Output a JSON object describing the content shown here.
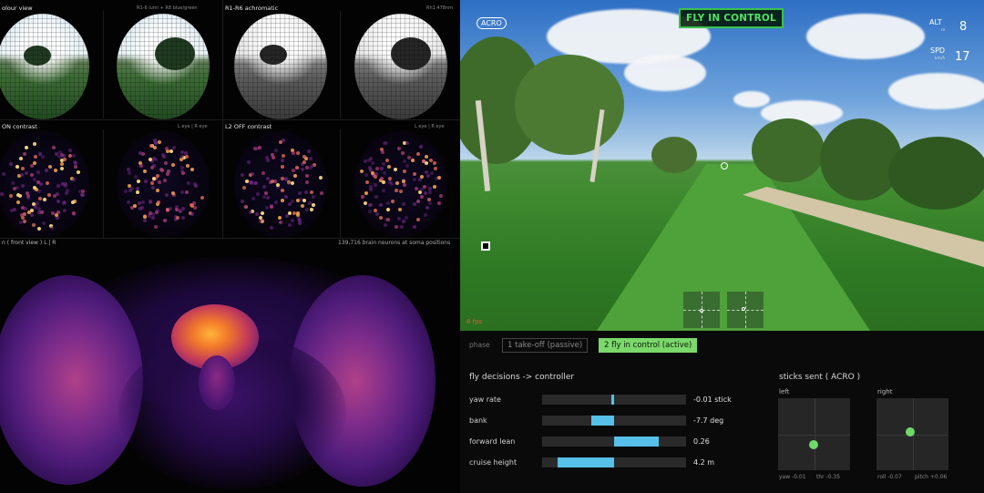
{
  "retina": {
    "top_left_label": "olour view",
    "top_left_meta": "R1-6 lumi + R8 blue/green",
    "top_right_label": "R1-R6 achromatic",
    "top_right_meta": "Rh1 478nm",
    "mid_left_label": "ON contrast",
    "mid_left_meta": "L eye | R eye",
    "mid_right_label": "L2 OFF contrast",
    "mid_right_meta": "L eye | R eye"
  },
  "brain": {
    "view_label": "n  ( front view )  L | R",
    "neurons_label": "139,716 brain neurons at soma positions"
  },
  "sim": {
    "mode_badge": "ACRO",
    "status": "FLY IN CONTROL",
    "alt_label": "ALT",
    "alt_unit": "m",
    "alt_value": "8",
    "spd_label": "SPD",
    "spd_unit": "km/h",
    "spd_value": "17",
    "fps_label": "8 fps",
    "accent": "#38c24a"
  },
  "phase": {
    "label": "phase",
    "items": [
      {
        "label": "1  take-off  (passive)",
        "state": "inactive"
      },
      {
        "label": "2  fly in control  (active)",
        "state": "active"
      }
    ]
  },
  "decisions": {
    "title": "fly decisions  ->  controller",
    "rows": [
      {
        "label": "yaw rate",
        "value": "-0.01 stick",
        "fraction": -0.01
      },
      {
        "label": "bank",
        "value": "-7.7 deg",
        "fraction": -0.32
      },
      {
        "label": "forward lean",
        "value": "0.26",
        "fraction": 0.62
      },
      {
        "label": "cruise height",
        "value": "4.2 m",
        "fraction": -0.78
      }
    ],
    "bar_color": "#56c0e8"
  },
  "sticks": {
    "title": "sticks sent  ( ACRO )",
    "left": {
      "label": "left",
      "x": -0.01,
      "y": -0.35,
      "readout_a": "yaw -0.01",
      "readout_b": "thr -0.35"
    },
    "right": {
      "label": "right",
      "x": -0.07,
      "y": 0.06,
      "readout_a": "roll -0.07",
      "readout_b": "pitch +0.06"
    },
    "dot_color": "#6fd86a"
  }
}
